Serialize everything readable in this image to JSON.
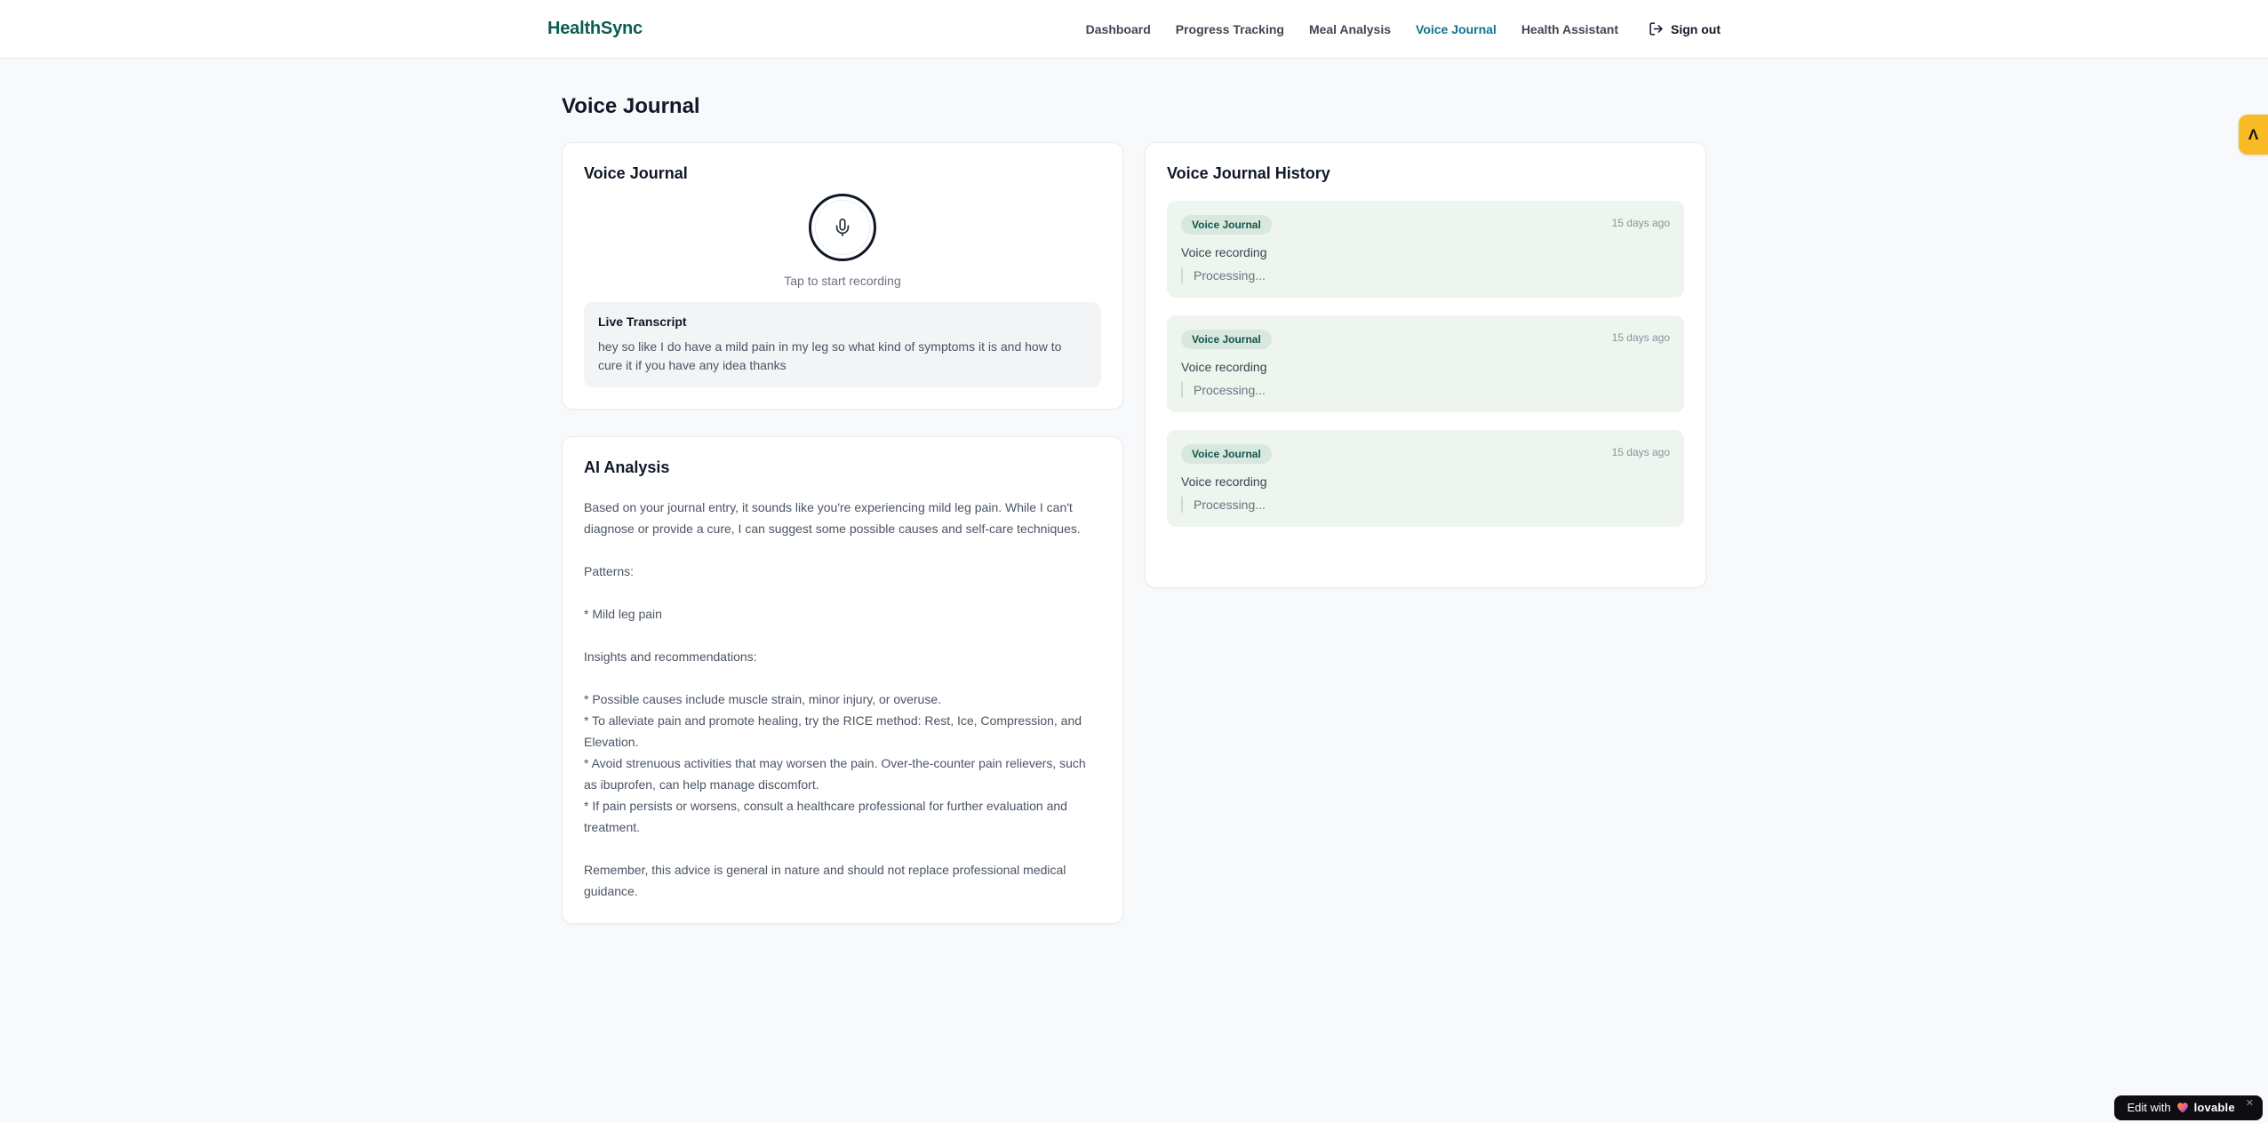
{
  "brand": "HealthSync",
  "nav": {
    "items": [
      {
        "label": "Dashboard"
      },
      {
        "label": "Progress Tracking"
      },
      {
        "label": "Meal Analysis"
      },
      {
        "label": "Voice Journal",
        "active": true
      },
      {
        "label": "Health Assistant"
      }
    ],
    "sign_out_label": "Sign out"
  },
  "page": {
    "title": "Voice Journal"
  },
  "recorder": {
    "title": "Voice Journal",
    "tap_label": "Tap to start recording",
    "transcript_title": "Live Transcript",
    "transcript_text": "hey so like I do have a mild pain in my leg so what kind of symptoms it is and how to cure it if you have any idea thanks"
  },
  "analysis": {
    "title": "AI Analysis",
    "paragraphs": [
      "Based on your journal entry, it sounds like you're experiencing mild leg pain. While I can't diagnose or provide a cure, I can suggest some possible causes and self-care techniques.",
      "Patterns:",
      "* Mild leg pain",
      "Insights and recommendations:",
      "* Possible causes include muscle strain, minor injury, or overuse.\n* To alleviate pain and promote healing, try the RICE method: Rest, Ice, Compression, and Elevation.\n* Avoid strenuous activities that may worsen the pain. Over-the-counter pain relievers, such as ibuprofen, can help manage discomfort.\n* If pain persists or worsens, consult a healthcare professional for further evaluation and treatment.",
      "Remember, this advice is general in nature and should not replace professional medical guidance."
    ]
  },
  "history": {
    "title": "Voice Journal History",
    "entries": [
      {
        "badge": "Voice Journal",
        "time": "15 days ago",
        "label": "Voice recording",
        "status": "Processing..."
      },
      {
        "badge": "Voice Journal",
        "time": "15 days ago",
        "label": "Voice recording",
        "status": "Processing..."
      },
      {
        "badge": "Voice Journal",
        "time": "15 days ago",
        "label": "Voice recording",
        "status": "Processing..."
      }
    ]
  },
  "overlays": {
    "preview_glyph": "Λ",
    "edit_with": "Edit with",
    "lovable": "lovable",
    "close": "✕"
  },
  "colors": {
    "brand": "#0b5d50",
    "nav_active": "#0e7490",
    "history_entry_bg": "#edf5ee",
    "chip_bg": "#d9e8de",
    "chip_text": "#13544b",
    "accent_amber": "#f8ba25"
  }
}
